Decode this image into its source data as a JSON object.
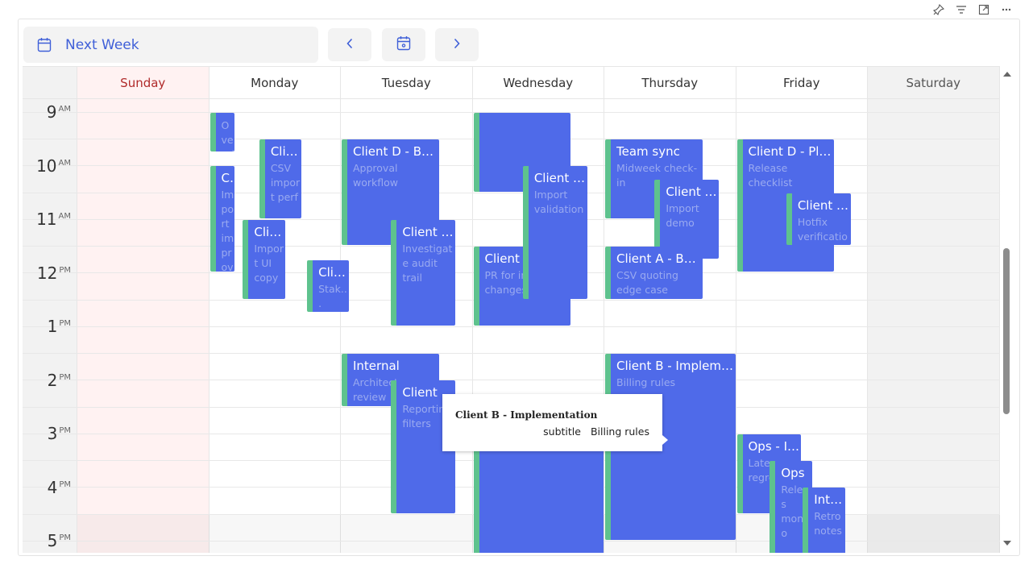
{
  "title": "Next Week",
  "icons": {
    "top": [
      "pin-icon",
      "filter-icon",
      "expand-icon",
      "more-icon"
    ],
    "calendar": "calendar-icon",
    "prev": "chevron-left-icon",
    "today": "calendar-today-icon",
    "next": "chevron-right-icon"
  },
  "days": [
    {
      "name": "Sunday",
      "color": "#b02a2a",
      "bg": "#fff2f2"
    },
    {
      "name": "Monday",
      "color": "#333333",
      "bg": "#ffffff"
    },
    {
      "name": "Tuesday",
      "color": "#333333",
      "bg": "#ffffff"
    },
    {
      "name": "Wednesday",
      "color": "#333333",
      "bg": "#ffffff"
    },
    {
      "name": "Thursday",
      "color": "#333333",
      "bg": "#ffffff"
    },
    {
      "name": "Friday",
      "color": "#333333",
      "bg": "#ffffff"
    },
    {
      "name": "Saturday",
      "color": "#555555",
      "bg": "#f2f2f2"
    }
  ],
  "hours": [
    {
      "h": "9",
      "ampm": "AM"
    },
    {
      "h": "10",
      "ampm": "AM"
    },
    {
      "h": "11",
      "ampm": "AM"
    },
    {
      "h": "12",
      "ampm": "PM"
    },
    {
      "h": "1",
      "ampm": "PM"
    },
    {
      "h": "2",
      "ampm": "PM"
    },
    {
      "h": "3",
      "ampm": "PM"
    },
    {
      "h": "4",
      "ampm": "PM"
    },
    {
      "h": "5",
      "ampm": "PM"
    }
  ],
  "colors": {
    "event": "#4f6ae9",
    "event_accent": "#5ec28e",
    "today_hdr": "#b02a2a"
  },
  "events": [
    {
      "day": 1,
      "start": 8.5,
      "end": 9.25,
      "lane": 0,
      "lanes": 5,
      "title": "",
      "subtitle": "Overnight a"
    },
    {
      "day": 1,
      "start": 9.5,
      "end": 11.5,
      "lane": 0,
      "lanes": 5,
      "title": "Client A...",
      "subtitle": "Import improve..."
    },
    {
      "day": 1,
      "start": 9.0,
      "end": 10.5,
      "lane": 1.5,
      "lanes": 3,
      "title": "Client A...",
      "subtitle": "CSV import perf"
    },
    {
      "day": 1,
      "start": 10.5,
      "end": 12.0,
      "lane": 1,
      "lanes": 3,
      "title": "Client A...",
      "subtitle": "Import UI copy"
    },
    {
      "day": 1,
      "start": 11.25,
      "end": 12.25,
      "lane": 3,
      "lanes": 3.05,
      "title": "Clie...",
      "subtitle": "Stak... check-"
    },
    {
      "day": 2,
      "start": 9.0,
      "end": 11.0,
      "lane": 0,
      "lanes": 1.33,
      "title": "Client D - Bug...",
      "subtitle": "Approval workflow"
    },
    {
      "day": 2,
      "start": 10.5,
      "end": 12.5,
      "lane": 1,
      "lanes": 2,
      "title": "Client D...",
      "subtitle": "Investigate audit trail"
    },
    {
      "day": 2,
      "start": 13.0,
      "end": 14.0,
      "lane": 0,
      "lanes": 1.33,
      "title": "Internal",
      "subtitle": "Architecture review"
    },
    {
      "day": 2,
      "start": 13.5,
      "end": 16.0,
      "lane": 1,
      "lanes": 2,
      "title": "Client B...",
      "subtitle": "Reporting filters"
    },
    {
      "day": 3,
      "start": 8.5,
      "end": 10.0,
      "lane": 0,
      "lanes": 1.33,
      "title": "",
      "subtitle": ""
    },
    {
      "day": 3,
      "start": 11.0,
      "end": 12.5,
      "lane": 0,
      "lanes": 1.33,
      "title": "Client A - ...",
      "subtitle": "PR for import changes"
    },
    {
      "day": 3,
      "start": 9.5,
      "end": 12.0,
      "lane": 1,
      "lanes": 2,
      "title": "Client A...",
      "subtitle": "Import validation"
    },
    {
      "day": 3,
      "start": 14.0,
      "end": 17.0,
      "lane": 0,
      "lanes": 1,
      "title": "Client C - Implemen...",
      "subtitle": ""
    },
    {
      "day": 4,
      "start": 9.0,
      "end": 10.5,
      "lane": 0,
      "lanes": 1.33,
      "title": "Team sync",
      "subtitle": "Midweek check-in"
    },
    {
      "day": 4,
      "start": 9.75,
      "end": 11.25,
      "lane": 1,
      "lanes": 2,
      "title": "Client A...",
      "subtitle": "Import demo"
    },
    {
      "day": 4,
      "start": 11.0,
      "end": 12.0,
      "lane": 0,
      "lanes": 1.33,
      "title": "Client A - Bug...",
      "subtitle": "CSV quoting edge case"
    },
    {
      "day": 4,
      "start": 13.0,
      "end": 16.5,
      "lane": 0,
      "lanes": 1,
      "title": "Client B - Implemen...",
      "subtitle": "Billing rules"
    },
    {
      "day": 5,
      "start": 9.0,
      "end": 11.5,
      "lane": 0,
      "lanes": 1.33,
      "title": "Client D - Pla...",
      "subtitle": "Release checklist"
    },
    {
      "day": 5,
      "start": 10.0,
      "end": 11.0,
      "lane": 1,
      "lanes": 2,
      "title": "Client D...",
      "subtitle": "Hotfix verification"
    },
    {
      "day": 5,
      "start": 14.5,
      "end": 16.0,
      "lane": 0,
      "lanes": 2,
      "title": "Ops - In...",
      "subtitle": "Latenc regress"
    },
    {
      "day": 5,
      "start": 15.0,
      "end": 17.0,
      "lane": 1,
      "lanes": 3,
      "title": "Ops",
      "subtitle": "Releas monito"
    },
    {
      "day": 5,
      "start": 15.5,
      "end": 17.0,
      "lane": 2,
      "lanes": 3,
      "title": "Inte...",
      "subtitle": "Retro notes"
    }
  ],
  "tooltip": {
    "title": "Client B - Implementation",
    "label": "subtitle",
    "value": "Billing rules"
  }
}
